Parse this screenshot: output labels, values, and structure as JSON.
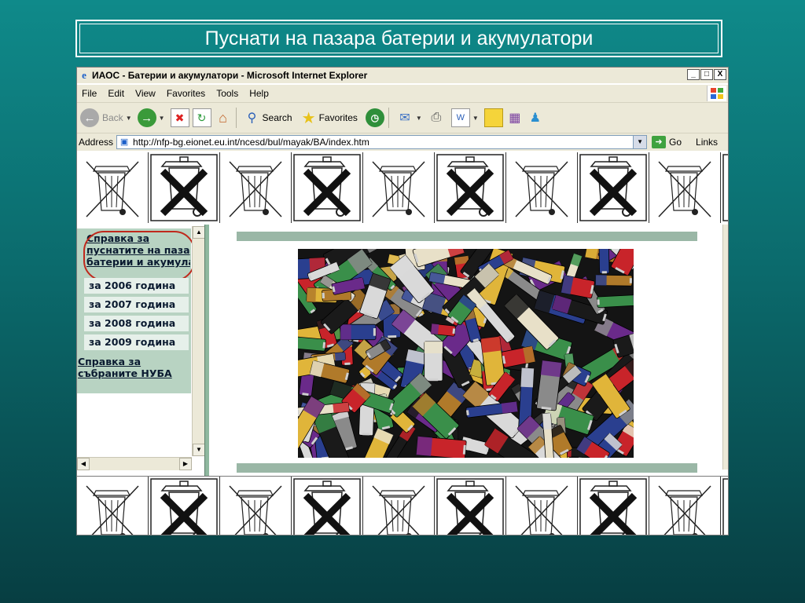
{
  "slide": {
    "title": "Пуснати на пазара батерии и акумулатори"
  },
  "browser": {
    "window_title": "ИАОС - Батерии и акумулатори - Microsoft Internet Explorer",
    "controls": {
      "minimize": "_",
      "maximize": "□",
      "close": "X"
    },
    "menu": [
      "File",
      "Edit",
      "View",
      "Favorites",
      "Tools",
      "Help"
    ],
    "toolbar": {
      "back": "Back",
      "search": "Search",
      "favorites": "Favorites"
    },
    "address": {
      "label": "Address",
      "url": "http://nfp-bg.eionet.eu.int/ncesd/bul/mayak/BA/index.htm",
      "go": "Go",
      "links": "Links"
    }
  },
  "nav": {
    "market_report": "Справка за пуснатите на пазара батерии и акумулатори",
    "market_report_lines": [
      "Справка за",
      "пуснатите на пазара",
      "батерии и акумулатори"
    ],
    "years": [
      "за 2006 година",
      "за 2007 година",
      "за 2008 година",
      "за 2009 година"
    ],
    "collected_report_lines": [
      "Справка за",
      "събраните НУБА"
    ]
  },
  "colors": {
    "background_top": "#0f8a8a",
    "background_bottom": "#073e42",
    "nav_bg": "#b8d3c2",
    "highlight_ring": "#c0281c",
    "rule": "#9ab7a6"
  },
  "icons": {
    "banner_tile_plain": "crossed-out-bin-icon",
    "banner_tile_boxed": "bin-with-big-x-icon",
    "ie_logo": "internet-explorer-icon"
  }
}
